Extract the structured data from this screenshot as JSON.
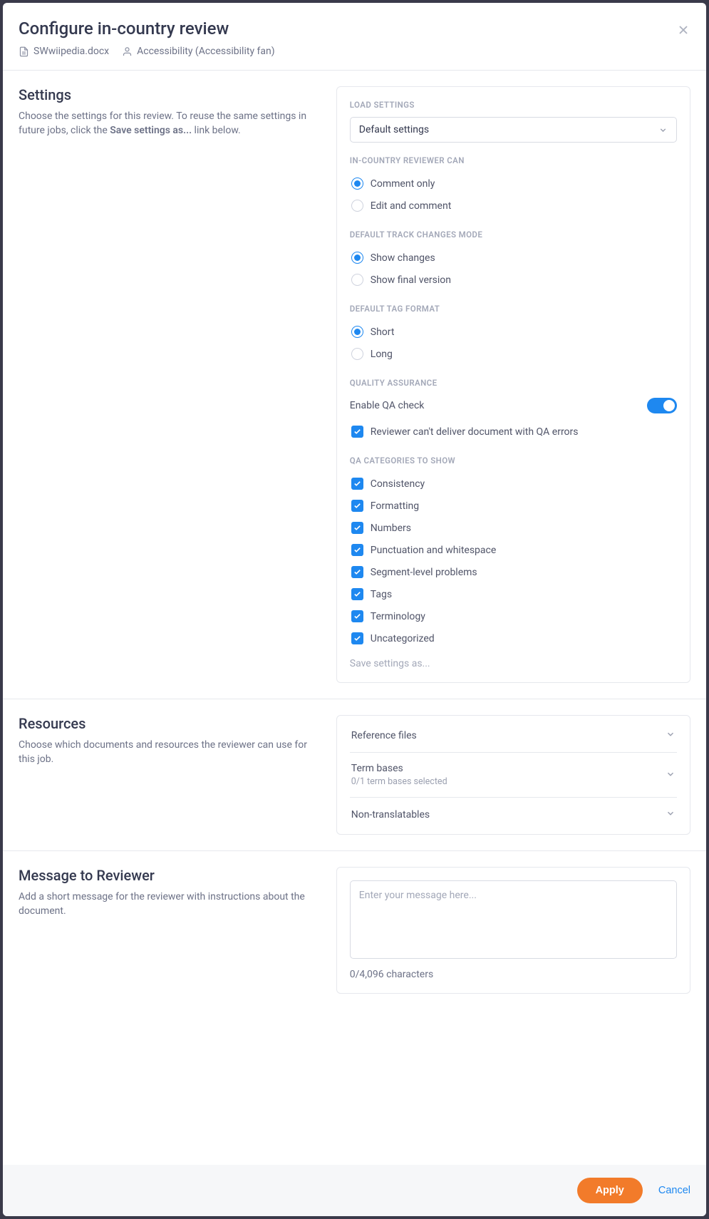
{
  "header": {
    "title": "Configure in-country review",
    "filename": "SWwiipedia.docx",
    "assignee": "Accessibility (Accessibility fan)"
  },
  "settings": {
    "title": "Settings",
    "desc_pre": "Choose the settings for this review. To reuse the same settings in future jobs, click the ",
    "desc_strong": "Save settings as...",
    "desc_post": " link below.",
    "load_settings_label": "LOAD SETTINGS",
    "load_settings_value": "Default settings",
    "reviewer_can_label": "IN-COUNTRY REVIEWER CAN",
    "reviewer_can": [
      {
        "label": "Comment only",
        "checked": true
      },
      {
        "label": "Edit and comment",
        "checked": false
      }
    ],
    "track_changes_label": "DEFAULT TRACK CHANGES MODE",
    "track_changes": [
      {
        "label": "Show changes",
        "checked": true
      },
      {
        "label": "Show final version",
        "checked": false
      }
    ],
    "tag_format_label": "DEFAULT TAG FORMAT",
    "tag_format": [
      {
        "label": "Short",
        "checked": true
      },
      {
        "label": "Long",
        "checked": false
      }
    ],
    "qa_label": "QUALITY ASSURANCE",
    "qa_enable_label": "Enable QA check",
    "qa_enable": true,
    "qa_block_label": "Reviewer can't deliver document with QA errors",
    "qa_cats_label": "QA CATEGORIES TO SHOW",
    "qa_cats": [
      "Consistency",
      "Formatting",
      "Numbers",
      "Punctuation and whitespace",
      "Segment-level problems",
      "Tags",
      "Terminology",
      "Uncategorized"
    ],
    "save_link": "Save settings as..."
  },
  "resources": {
    "title": "Resources",
    "desc": "Choose which documents and resources the reviewer can use for this job.",
    "items": [
      {
        "title": "Reference files",
        "sub": ""
      },
      {
        "title": "Term bases",
        "sub": "0/1 term bases selected"
      },
      {
        "title": "Non-translatables",
        "sub": ""
      }
    ]
  },
  "message": {
    "title": "Message to Reviewer",
    "desc": "Add a short message for the reviewer with instructions about the document.",
    "placeholder": "Enter your message here...",
    "count": "0/4,096 characters"
  },
  "footer": {
    "apply": "Apply",
    "cancel": "Cancel"
  }
}
